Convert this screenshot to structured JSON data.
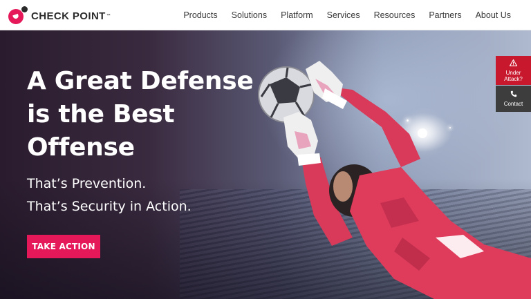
{
  "brand": {
    "name": "CHECK POINT",
    "tm": "™",
    "colors": {
      "accent": "#e5185a",
      "dark": "#2b2b2b",
      "alert": "#c8182e"
    }
  },
  "nav": {
    "items": [
      {
        "label": "Products"
      },
      {
        "label": "Solutions"
      },
      {
        "label": "Platform"
      },
      {
        "label": "Services"
      },
      {
        "label": "Resources"
      },
      {
        "label": "Partners"
      },
      {
        "label": "About Us"
      }
    ]
  },
  "hero": {
    "title_lines": [
      "A Great Defense",
      "is the Best",
      "Offense"
    ],
    "subtitle_lines": [
      "That’s Prevention.",
      "That’s Security in Action."
    ],
    "cta_label": "TAKE ACTION"
  },
  "side_widgets": {
    "attack": {
      "icon": "warning-icon",
      "label_line1": "Under",
      "label_line2": "Attack?"
    },
    "contact": {
      "icon": "phone-icon",
      "label": "Contact"
    }
  }
}
